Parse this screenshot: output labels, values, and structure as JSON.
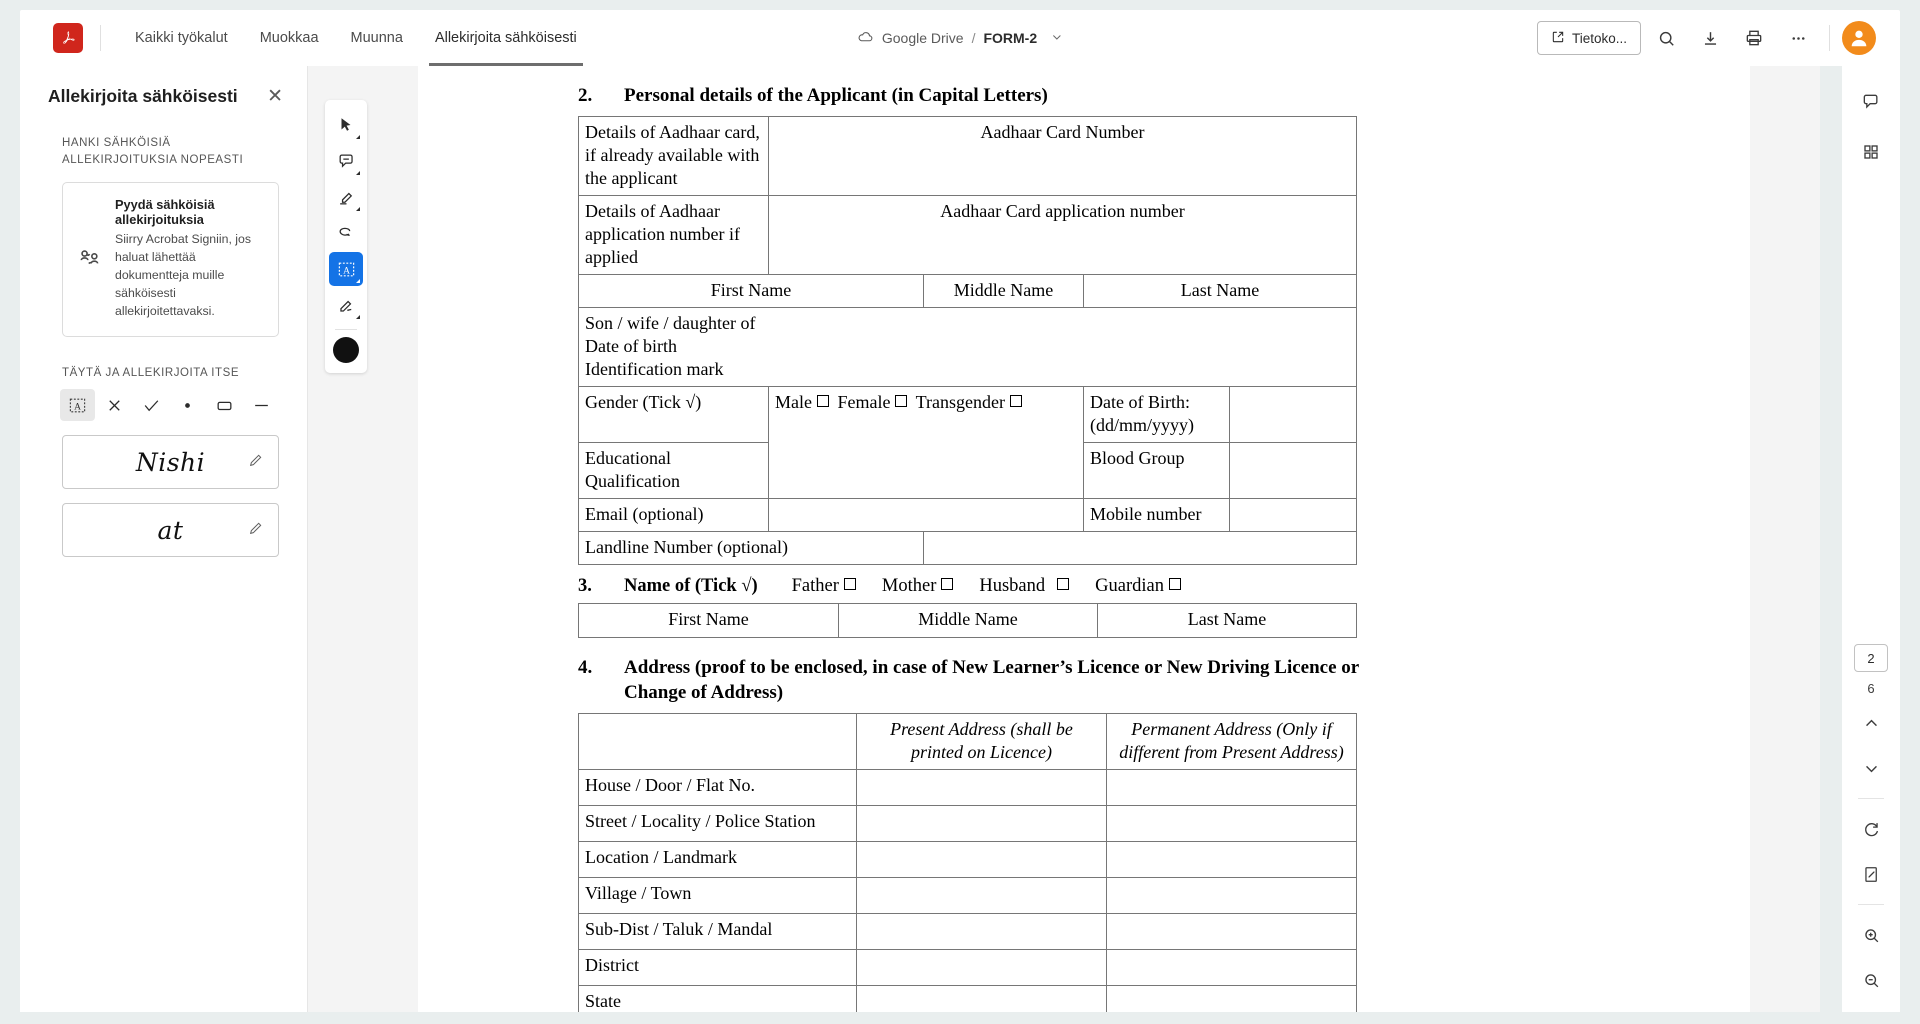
{
  "app": {
    "logo_icon": "acrobat-logo-icon",
    "menu": [
      {
        "label": "Kaikki työkalut",
        "active": false
      },
      {
        "label": "Muokkaa",
        "active": false
      },
      {
        "label": "Muunna",
        "active": false
      },
      {
        "label": "Allekirjoita sähköisesti",
        "active": true
      }
    ],
    "breadcrumb": {
      "cloud_icon": "cloud-icon",
      "location": "Google Drive",
      "separator": "/",
      "filename": "FORM-2",
      "chevron_icon": "chevron-down-icon"
    },
    "top_right": {
      "share_label": "Tietoko...",
      "share_icon": "external-link-icon",
      "search_icon": "search-icon",
      "download_icon": "download-icon",
      "print_icon": "print-icon",
      "more_icon": "more-horizontal-icon",
      "avatar_icon": "user-avatar-icon"
    }
  },
  "sidebar": {
    "title": "Allekirjoita sähköisesti",
    "close_icon": "close-icon",
    "section1_label": "HANKI SÄHKÖISIÄ ALLEKIRJOITUKSIA NOPEASTI",
    "promo": {
      "icon": "request-signatures-icon",
      "title": "Pyydä sähköisiä allekirjoituksia",
      "body": "Siirry Acrobat Signiin, jos haluat lähettää dokumentteja muille sähköisesti allekirjoitettavaksi."
    },
    "section2_label": "TÄYTÄ JA ALLEKIRJOITA ITSE",
    "stamps": [
      {
        "name": "text-box-tool",
        "glyph": "A",
        "selected": true
      },
      {
        "name": "cross-tool",
        "glyph": "✕",
        "selected": false
      },
      {
        "name": "check-tool",
        "glyph": "✓",
        "selected": false
      },
      {
        "name": "dot-tool",
        "glyph": "●",
        "selected": false
      },
      {
        "name": "rectangle-tool",
        "glyph": "▭",
        "selected": false
      },
      {
        "name": "line-tool",
        "glyph": "—",
        "selected": false
      }
    ],
    "signatures": [
      {
        "text": "Nishi",
        "edit_icon": "pencil-icon"
      },
      {
        "text": "at",
        "edit_icon": "pencil-icon"
      }
    ]
  },
  "toolstrip": [
    {
      "name": "select-tool-icon",
      "active": false,
      "has_caret": true
    },
    {
      "name": "comment-tool-icon",
      "active": false,
      "has_caret": true
    },
    {
      "name": "highlighter-tool-icon",
      "active": false,
      "has_caret": true
    },
    {
      "name": "lasso-erase-tool-icon",
      "active": false,
      "has_caret": false
    },
    {
      "name": "add-text-tool-icon",
      "active": true,
      "has_caret": true
    },
    {
      "name": "sign-tool-icon",
      "active": false,
      "has_caret": true
    },
    {
      "name": "color-swatch",
      "active": false,
      "has_caret": false
    }
  ],
  "right_rail": {
    "comment_icon": "comment-panel-icon",
    "thumbnails_icon": "page-thumbnails-icon",
    "current_page": "2",
    "total_pages": "6",
    "prev_icon": "chevron-up-icon",
    "next_icon": "chevron-down-icon",
    "rotate_icon": "rotate-clockwise-icon",
    "fit_page_icon": "fit-page-icon",
    "zoom_in_icon": "zoom-in-icon",
    "zoom_out_icon": "zoom-out-icon"
  },
  "document": {
    "section2": {
      "number": "2.",
      "title": "Personal details of the Applicant (in Capital Letters)",
      "rows": {
        "aadhaar_label": "Details of Aadhaar card, if already available with the applicant",
        "aadhaar_value": "Aadhaar Card Number",
        "aadhaar_app_label": "Details of Aadhaar application number if applied",
        "aadhaar_app_value": "Aadhaar Card application number",
        "first_name": "First Name",
        "middle_name": "Middle Name",
        "last_name": "Last Name",
        "relation_line1": "Son / wife / daughter of",
        "relation_line2": "Date of birth",
        "relation_line3": "Identification mark",
        "gender_label": "Gender (Tick √)",
        "gender_male": "Male",
        "gender_female": "Female",
        "gender_transgender": "Transgender",
        "dob_label": "Date of Birth: (dd/mm/yyyy)",
        "education_label": "Educational Qualification",
        "blood_group_label": "Blood Group",
        "email_label": "Email (optional)",
        "mobile_label": "Mobile number",
        "landline_label": "Landline Number (optional)"
      }
    },
    "section3": {
      "number": "3.",
      "title": "Name of (Tick √)",
      "options": [
        "Father",
        "Mother",
        "Husband",
        "Guardian"
      ],
      "columns": [
        "First Name",
        "Middle Name",
        "Last Name"
      ]
    },
    "section4": {
      "number": "4.",
      "title": "Address (proof to be enclosed, in case of New Learner’s Licence or New Driving Licence or Change of Address)",
      "col_blank": "",
      "col_present": "Present Address (shall be printed on Licence)",
      "col_permanent": "Permanent Address (Only if different from Present Address)",
      "rows": [
        "House / Door / Flat No.",
        "Street / Locality / Police Station",
        "Location / Landmark",
        "Village / Town",
        "Sub-Dist / Taluk / Mandal",
        "District",
        "State"
      ]
    }
  }
}
